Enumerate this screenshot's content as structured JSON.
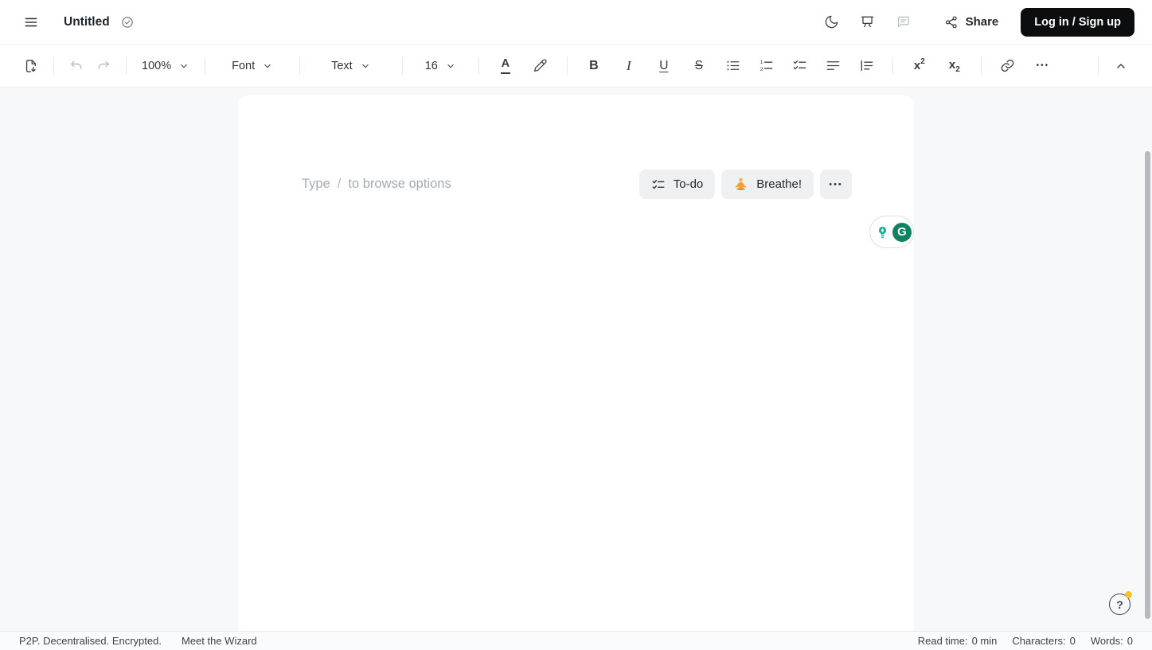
{
  "topbar": {
    "title": "Untitled",
    "share_label": "Share",
    "login_button": "Log in / Sign up"
  },
  "toolbar": {
    "zoom": "100%",
    "font": "Font",
    "paragraph_style": "Text",
    "font_size": "16",
    "glyphs": {
      "text_color": "A",
      "bold": "B",
      "italic": "I",
      "underline": "U",
      "strikethrough": "S",
      "script_base": "x",
      "superscript_mark": "2",
      "subscript_mark": "2",
      "more": "•••"
    }
  },
  "editor": {
    "placeholder": {
      "prefix": "Type",
      "slash": "/",
      "suffix": "to browse options"
    },
    "quick_actions": {
      "todo": "To-do",
      "breathe": "Breathe!",
      "more": "•••"
    },
    "grammarly": {
      "letter": "G"
    }
  },
  "statusbar": {
    "tagline": "P2P. Decentralised. Encrypted.",
    "wizard": "Meet the Wizard",
    "read_time_label": "Read time:",
    "read_time_value": "0 min",
    "characters_label": "Characters:",
    "characters_value": "0",
    "words_label": "Words:",
    "words_value": "0"
  },
  "help": {
    "mark": "?"
  },
  "colors": {
    "accent_black": "#0c0d0e",
    "grammarly_green": "#14b394",
    "grammarly_badge": "#10825f",
    "notification_yellow": "#f7c325",
    "content_background": "#f7f8fa"
  }
}
